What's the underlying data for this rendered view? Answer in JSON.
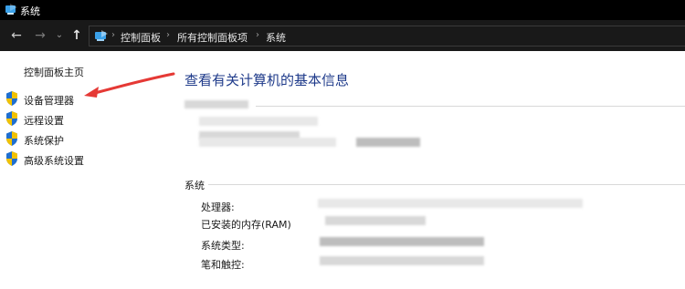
{
  "window": {
    "title": "系统"
  },
  "nav": {
    "back": "←",
    "forward": "→",
    "recent": "⌄",
    "up": "↑",
    "breadcrumbs": [
      "控制面板",
      "所有控制面板项",
      "系统"
    ],
    "separator": "›"
  },
  "sidebar": {
    "home": "控制面板主页",
    "items": [
      {
        "label": "设备管理器"
      },
      {
        "label": "远程设置"
      },
      {
        "label": "系统保护"
      },
      {
        "label": "高级系统设置"
      }
    ]
  },
  "main": {
    "title": "查看有关计算机的基本信息",
    "system_section": "系统",
    "rows": [
      {
        "label": "处理器:"
      },
      {
        "label": "已安装的内存(RAM)"
      },
      {
        "label": "系统类型:"
      },
      {
        "label": "笔和触控:"
      }
    ]
  },
  "colors": {
    "title_blue": "#1e3a8a",
    "annotation_arrow": "#e53935",
    "shield_blue": "#1f6fd0",
    "shield_yellow": "#f2c200"
  }
}
